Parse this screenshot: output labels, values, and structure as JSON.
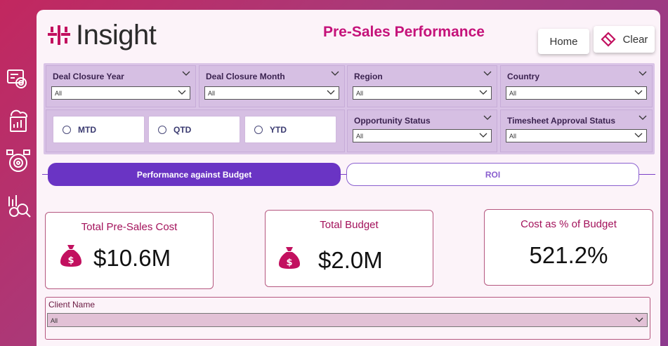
{
  "header": {
    "logo_text": "Insight",
    "title": "Pre-Sales Performance",
    "home_label": "Home",
    "clear_label": "Clear"
  },
  "nav": {
    "icons": [
      "gear-settings-icon",
      "cloud-report-icon",
      "target-settings-icon",
      "analytics-search-icon"
    ]
  },
  "filters": {
    "deal_closure_year": {
      "label": "Deal Closure Year",
      "value": "All"
    },
    "deal_closure_month": {
      "label": "Deal Closure Month",
      "value": "All"
    },
    "region": {
      "label": "Region",
      "value": "All"
    },
    "country": {
      "label": "Country",
      "value": "All"
    },
    "opportunity_status": {
      "label": "Opportunity Status",
      "value": "All"
    },
    "timesheet_approval_status": {
      "label": "Timesheet Approval Status",
      "value": "All"
    },
    "period": {
      "mtd": "MTD",
      "qtd": "QTD",
      "ytd": "YTD"
    }
  },
  "tabs": {
    "performance": "Performance against Budget",
    "roi": "ROI"
  },
  "kpis": {
    "total_presales_cost": {
      "title": "Total Pre-Sales Cost",
      "value": "$10.6M"
    },
    "total_budget": {
      "title": "Total Budget",
      "value": "$2.0M"
    },
    "cost_pct_budget": {
      "title": "Cost as % of Budget",
      "value": "521.2%"
    }
  },
  "client": {
    "label": "Client Name",
    "value": "All"
  },
  "colors": {
    "accent": "#c5127a",
    "tab_active": "#6a34c4",
    "filter_bg": "#d9c3e6",
    "money_bag": "#c2105f"
  }
}
